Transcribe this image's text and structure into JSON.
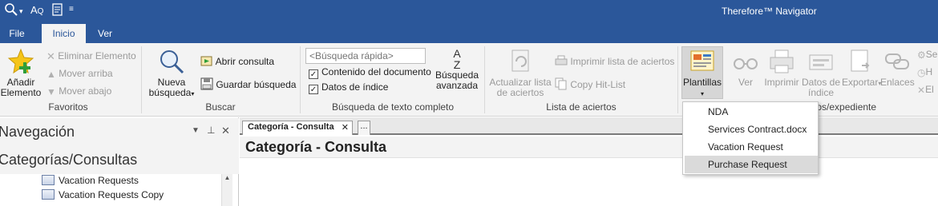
{
  "app": {
    "title": "Therefore™ Navigator"
  },
  "tabs": [
    {
      "label": "File"
    },
    {
      "label": "Inicio"
    },
    {
      "label": "Ver"
    }
  ],
  "ribbon": {
    "favoritos": {
      "group_label": "Favoritos",
      "add_label_1": "Añadir",
      "add_label_2": "Elemento",
      "remove": "Eliminar Elemento",
      "move_up": "Mover arriba",
      "move_down": "Mover abajo"
    },
    "buscar": {
      "group_label": "Buscar",
      "new_search_1": "Nueva",
      "new_search_2": "búsqueda",
      "open_query": "Abrir consulta",
      "save_search": "Guardar búsqueda"
    },
    "fulltext": {
      "group_label": "Búsqueda de texto completo",
      "quick_search_placeholder": "<Búsqueda rápida>",
      "content_label": "Contenido del documento",
      "index_label": "Datos de índice",
      "advanced_1": "Búsqueda",
      "advanced_2": "avanzada"
    },
    "hitlist": {
      "group_label": "Lista de aciertos",
      "refresh_1": "Actualizar lista",
      "refresh_2": "de aciertos",
      "print_list": "Imprimir lista de aciertos",
      "copy_hitlist": "Copy Hit-List"
    },
    "documento": {
      "group_label_partial": "tos/expediente",
      "templates": "Plantillas",
      "view": "Ver",
      "print": "Imprimir",
      "index_1": "Datos de",
      "index_2": "índice",
      "export": "Exportar",
      "links": "Enlaces",
      "cut_1": "Se",
      "cut_2": "H",
      "cut_3": "El"
    }
  },
  "navigation": {
    "title": "Navegación",
    "categories_title": "Categorías/Consultas",
    "tree": [
      {
        "label": "Vacation Requests"
      },
      {
        "label": "Vacation Requests Copy"
      }
    ]
  },
  "document": {
    "tab_label": "Categoría - Consulta",
    "tab_more": "...",
    "heading": "Categoría - Consulta"
  },
  "templates_menu": {
    "items": [
      {
        "label": "NDA"
      },
      {
        "label": "Services Contract.docx"
      },
      {
        "label": "Vacation Request"
      },
      {
        "label": "Purchase Request"
      }
    ]
  },
  "colors": {
    "accent": "#2b579a",
    "ribbon_bg": "#f3f3f3"
  }
}
